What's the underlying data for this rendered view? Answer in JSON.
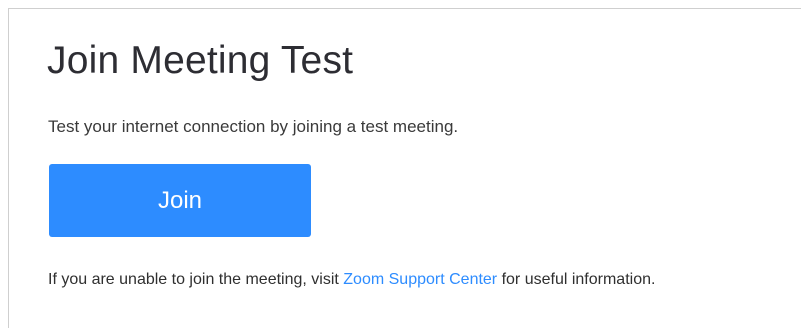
{
  "page": {
    "title": "Join Meeting Test",
    "subtitle": "Test your internet connection by joining a test meeting.",
    "join_button_label": "Join",
    "footer": {
      "prefix": "If you are unable to join the meeting, visit ",
      "link_text": "Zoom Support Center",
      "suffix": " for useful information."
    }
  },
  "colors": {
    "accent": "#2d8cff",
    "text": "#333333",
    "border": "#cfcfcf"
  }
}
